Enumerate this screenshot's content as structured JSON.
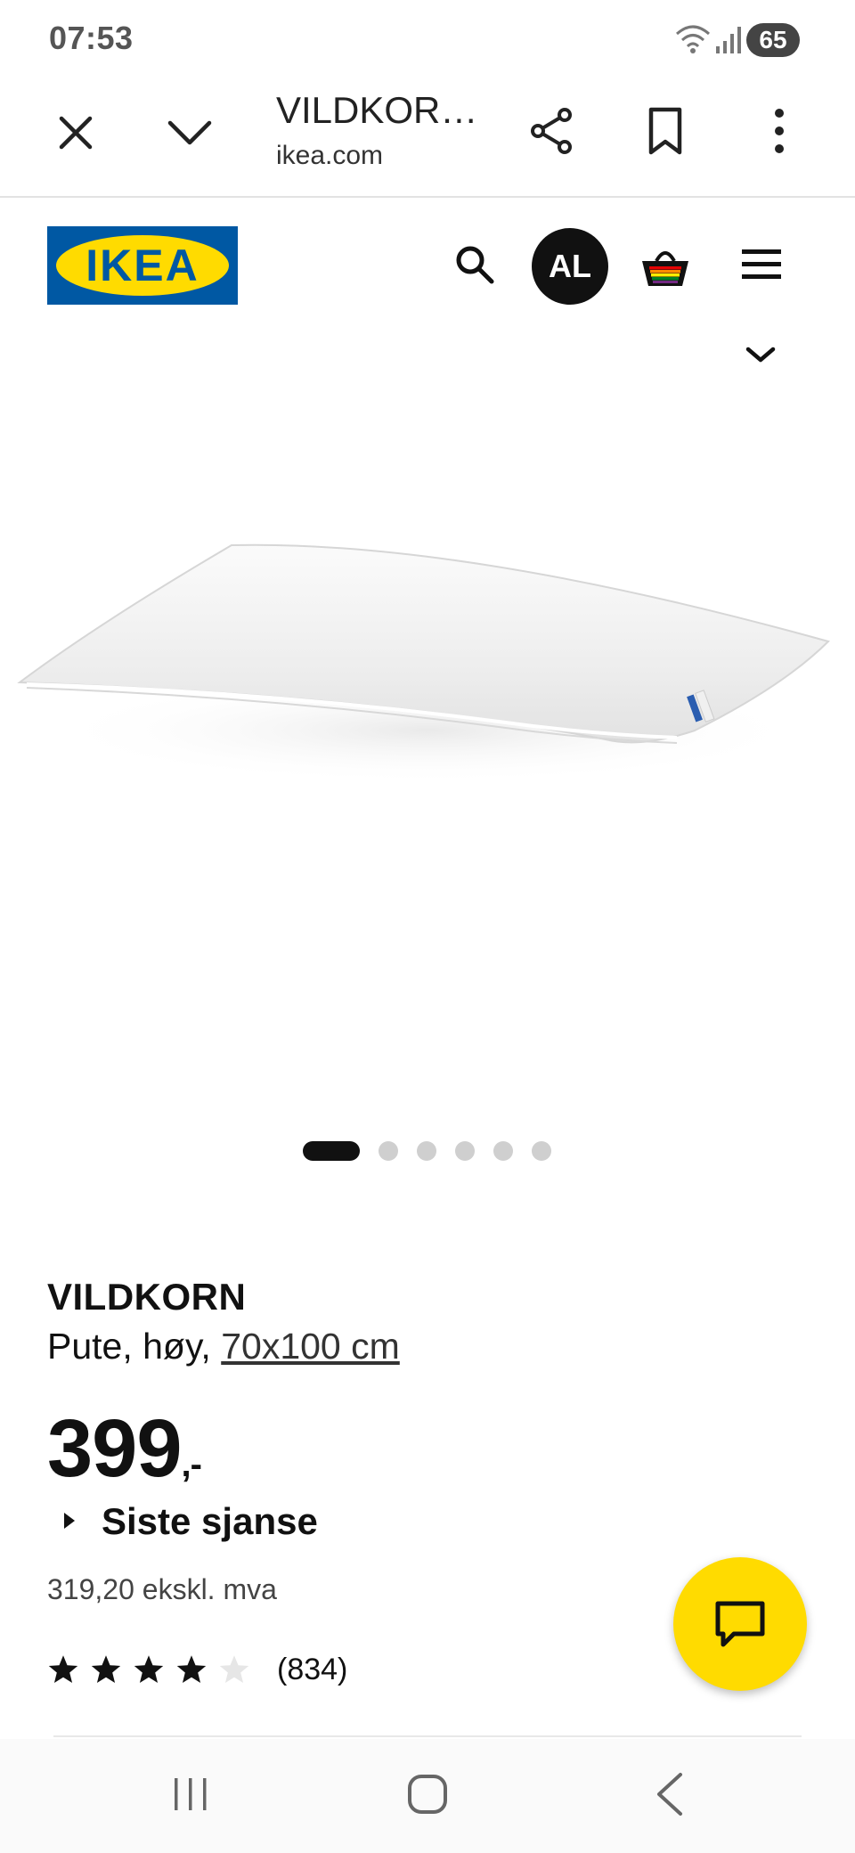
{
  "status_bar": {
    "time": "07:53",
    "battery": "65"
  },
  "browser": {
    "title": "VILDKOR…",
    "url": "ikea.com"
  },
  "site": {
    "logo_text": "IKEA",
    "avatar_initials": "AL"
  },
  "product": {
    "name": "VILDKORN",
    "description_prefix": "Pute, høy, ",
    "size_link": "70x100 cm",
    "price": "399",
    "price_suffix": ",-",
    "promo_label": "Siste sjanse",
    "price_ex_vat": "319,20 ekskl. mva",
    "rating": 4,
    "rating_max": 5,
    "review_count": "(834)"
  },
  "carousel": {
    "total": 6,
    "active_index": 0
  },
  "colors": {
    "ikea_blue": "#0058a3",
    "ikea_yellow": "#ffdb00",
    "text": "#111111"
  },
  "icons": [
    "close-icon",
    "chevron-down-icon",
    "share-icon",
    "bookmark-icon",
    "more-vert-icon",
    "search-icon",
    "basket-icon",
    "hamburger-menu-icon",
    "chat-icon",
    "star-icon",
    "recents-icon",
    "home-icon",
    "back-icon"
  ]
}
